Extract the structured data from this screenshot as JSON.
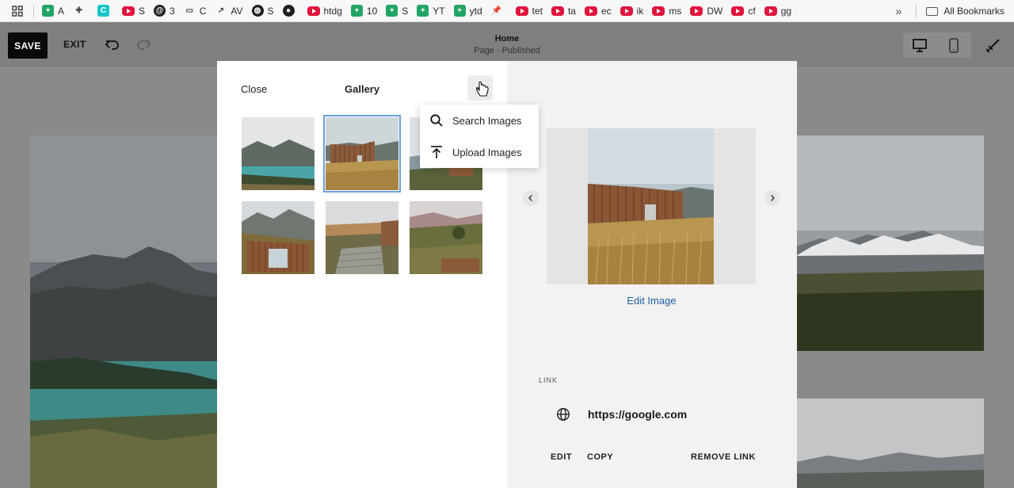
{
  "bookmarks_bar": {
    "items": [
      {
        "label": "A",
        "icon": "sheets-icon"
      },
      {
        "label": "",
        "icon": "puzzle-icon"
      },
      {
        "label": "",
        "icon": "c-app-icon"
      },
      {
        "label": "S",
        "icon": "youtube-icon"
      },
      {
        "label": "3",
        "icon": "threads-icon"
      },
      {
        "label": "C",
        "icon": "folder-icon"
      },
      {
        "label": "AV",
        "icon": "chart-line-icon"
      },
      {
        "label": "S",
        "icon": "globe-icon"
      },
      {
        "label": "",
        "icon": "github-icon"
      },
      {
        "label": "htdg",
        "icon": "youtube-icon"
      },
      {
        "label": "10",
        "icon": "sheets-icon"
      },
      {
        "label": "S",
        "icon": "sheets-icon"
      },
      {
        "label": "YT",
        "icon": "sheets-icon"
      },
      {
        "label": "ytd",
        "icon": "sheets-icon"
      },
      {
        "label": "",
        "icon": "pin-icon"
      },
      {
        "label": "tet",
        "icon": "youtube-icon"
      },
      {
        "label": "ta",
        "icon": "youtube-icon"
      },
      {
        "label": "ec",
        "icon": "youtube-icon"
      },
      {
        "label": "ik",
        "icon": "youtube-icon"
      },
      {
        "label": "ms",
        "icon": "youtube-icon"
      },
      {
        "label": "DW",
        "icon": "youtube-icon"
      },
      {
        "label": "cf",
        "icon": "youtube-icon"
      },
      {
        "label": "gg",
        "icon": "youtube-icon"
      }
    ],
    "more": "»",
    "all_bookmarks": "All Bookmarks"
  },
  "editor": {
    "save_label": "SAVE",
    "exit_label": "EXIT",
    "page_title": "Home",
    "page_status": "Page · Published"
  },
  "gallery_panel": {
    "close_label": "Close",
    "title": "Gallery",
    "add_button": "+",
    "menu": {
      "search_images": "Search Images",
      "upload_images": "Upload Images"
    }
  },
  "image_panel": {
    "edit_image": "Edit Image",
    "link_label": "LINK",
    "link_url": "https://google.com",
    "edit": "EDIT",
    "copy": "COPY",
    "remove_link": "REMOVE LINK"
  },
  "colors": {
    "accent_link": "#1f5fa3",
    "selected_outline": "#6aa0d8",
    "save_bg": "#0a0a0a"
  }
}
